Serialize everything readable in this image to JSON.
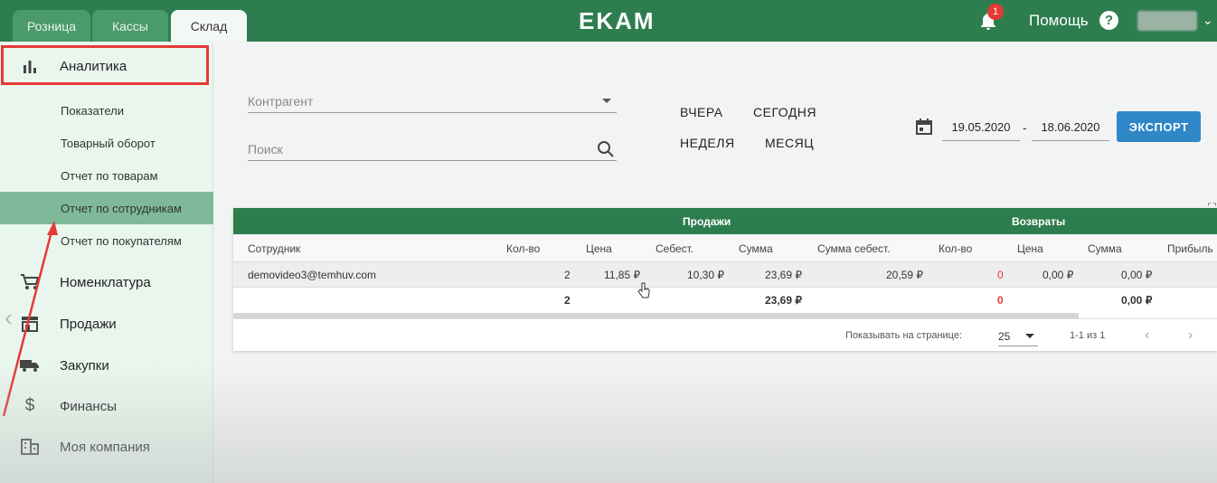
{
  "top_tabs": [
    {
      "label": "Розница"
    },
    {
      "label": "Кассы"
    },
    {
      "label": "Склад"
    }
  ],
  "brand": {
    "logo": "EKAM"
  },
  "notifications": {
    "count": "1",
    "icon": "bell-icon"
  },
  "help": {
    "label": "Помощь",
    "icon_glyph": "?"
  },
  "sidebar": {
    "section_title": "Аналитика",
    "sub_items": [
      {
        "label": "Показатели"
      },
      {
        "label": "Товарный оборот"
      },
      {
        "label": "Отчет по товарам"
      },
      {
        "label": "Отчет по сотрудникам"
      },
      {
        "label": "Отчет по покупателям"
      }
    ],
    "main_items": [
      {
        "label": "Номенклатура",
        "icon": "cart-icon"
      },
      {
        "label": "Продажи",
        "icon": "store-icon"
      },
      {
        "label": "Закупки",
        "icon": "truck-icon"
      },
      {
        "label": "Финансы",
        "icon": "dollar-icon"
      },
      {
        "label": "Моя компания",
        "icon": "building-icon"
      }
    ]
  },
  "filters": {
    "counterparty_placeholder": "Контрагент",
    "search_placeholder": "Поиск",
    "quick_periods": {
      "yesterday": "ВЧЕРА",
      "today": "СЕГОДНЯ",
      "week": "НЕДЕЛЯ",
      "month": "МЕСЯЦ"
    },
    "date_from": "19.05.2020",
    "date_separator": "-",
    "date_to": "18.06.2020",
    "export_label": "ЭКСПОРТ"
  },
  "table": {
    "groups": {
      "sales": "Продажи",
      "returns": "Возвраты"
    },
    "columns": [
      "Сотрудник",
      "Кол-во",
      "Цена",
      "Себест.",
      "Сумма",
      "Сумма себест.",
      "Кол-во",
      "Цена",
      "Сумма",
      "Прибыль"
    ],
    "rows": [
      [
        "demovideo3@temhuv.com",
        "2",
        "11,85 ₽",
        "10,30 ₽",
        "23,69 ₽",
        "20,59 ₽",
        "0",
        "0,00 ₽",
        "0,00 ₽"
      ]
    ],
    "totals": {
      "qty": "2",
      "sum": "23,69 ₽",
      "ret_qty": "0",
      "ret_sum": "0,00 ₽"
    },
    "pagination": {
      "per_page_label": "Показывать на странице:",
      "per_page_value": "25",
      "range": "1-1 из 1"
    }
  },
  "colors": {
    "brand_green": "#2e7d4f",
    "accent_blue": "#2f87c8",
    "alert_red": "#e53935"
  }
}
